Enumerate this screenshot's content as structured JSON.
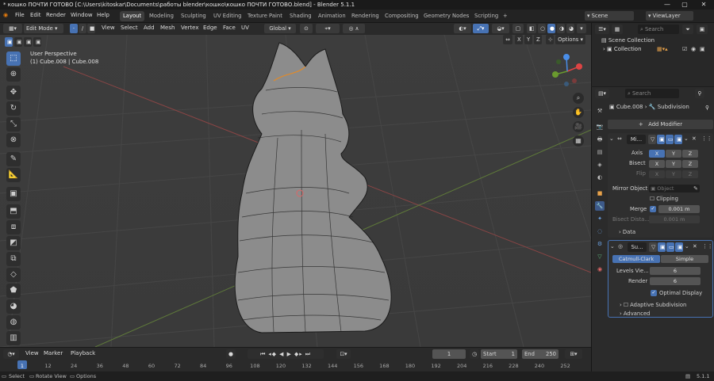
{
  "window": {
    "title": "* кошко ПОЧТИ ГОТОВО [C:\\Users\\kitoskar\\Documents\\работы blender\\кошко\\кошко ПОЧТИ ГОТОВО.blend] - Blender 5.1.1"
  },
  "menu": {
    "items": [
      "File",
      "Edit",
      "Render",
      "Window",
      "Help"
    ]
  },
  "workspaces": [
    "Layout",
    "Modeling",
    "Sculpting",
    "UV Editing",
    "Texture Paint",
    "Shading",
    "Animation",
    "Rendering",
    "Compositing",
    "Geometry Nodes",
    "Scripting"
  ],
  "active_workspace": "Layout",
  "scene": {
    "label": "Scene",
    "view_layer": "ViewLayer"
  },
  "viewport_header": {
    "mode": "Edit Mode",
    "menus": [
      "View",
      "Select",
      "Add",
      "Mesh",
      "Vertex",
      "Edge",
      "Face",
      "UV"
    ],
    "orientation": "Global",
    "options": "Options",
    "axes": [
      "X",
      "Y",
      "Z"
    ]
  },
  "viewport": {
    "perspective": "User Perspective",
    "object_info": "(1) Cube.008 | Cube.008"
  },
  "timeline": {
    "menus": [
      "View",
      "Marker",
      "Playback"
    ],
    "current_frame": "1",
    "start_label": "Start",
    "start": "1",
    "end_label": "End",
    "end": "250",
    "ticks": [
      "1",
      "12",
      "24",
      "36",
      "48",
      "60",
      "72",
      "84",
      "96",
      "108",
      "120",
      "132",
      "144",
      "156",
      "168",
      "180",
      "192",
      "204",
      "216",
      "228",
      "240",
      "252"
    ]
  },
  "status": {
    "select": "Select",
    "rotate": "Rotate View",
    "options": "Options",
    "version": "5.1.1"
  },
  "outliner": {
    "search_placeholder": "Search",
    "scene_collection": "Scene Collection",
    "collection": "Collection"
  },
  "properties": {
    "search_placeholder": "Search",
    "object": "Cube.008",
    "modifier_tab": "Subdivision",
    "add_modifier": "Add Modifier",
    "mirror": {
      "name": "Mi...",
      "axis_label": "Axis",
      "bisect_label": "Bisect",
      "flip_label": "Flip",
      "x": "X",
      "y": "Y",
      "z": "Z",
      "mirror_object_label": "Mirror Object",
      "object_placeholder": "Object",
      "clipping": "Clipping",
      "merge_label": "Merge",
      "merge_value": "0.001 m",
      "bisect_distance_label": "Bisect Dista...",
      "bisect_distance_value": "0.001 m",
      "data": "Data"
    },
    "subdivision": {
      "name": "Su...",
      "catmull": "Catmull-Clark",
      "simple": "Simple",
      "levels_label": "Levels Vie...",
      "levels": "6",
      "render_label": "Render",
      "render": "6",
      "optimal": "Optimal Display",
      "adaptive": "Adaptive Subdivision",
      "advanced": "Advanced"
    }
  },
  "colors": {
    "accent": "#4772b3",
    "header": "#2a2a2a",
    "viewport": "#3d3d3d"
  }
}
